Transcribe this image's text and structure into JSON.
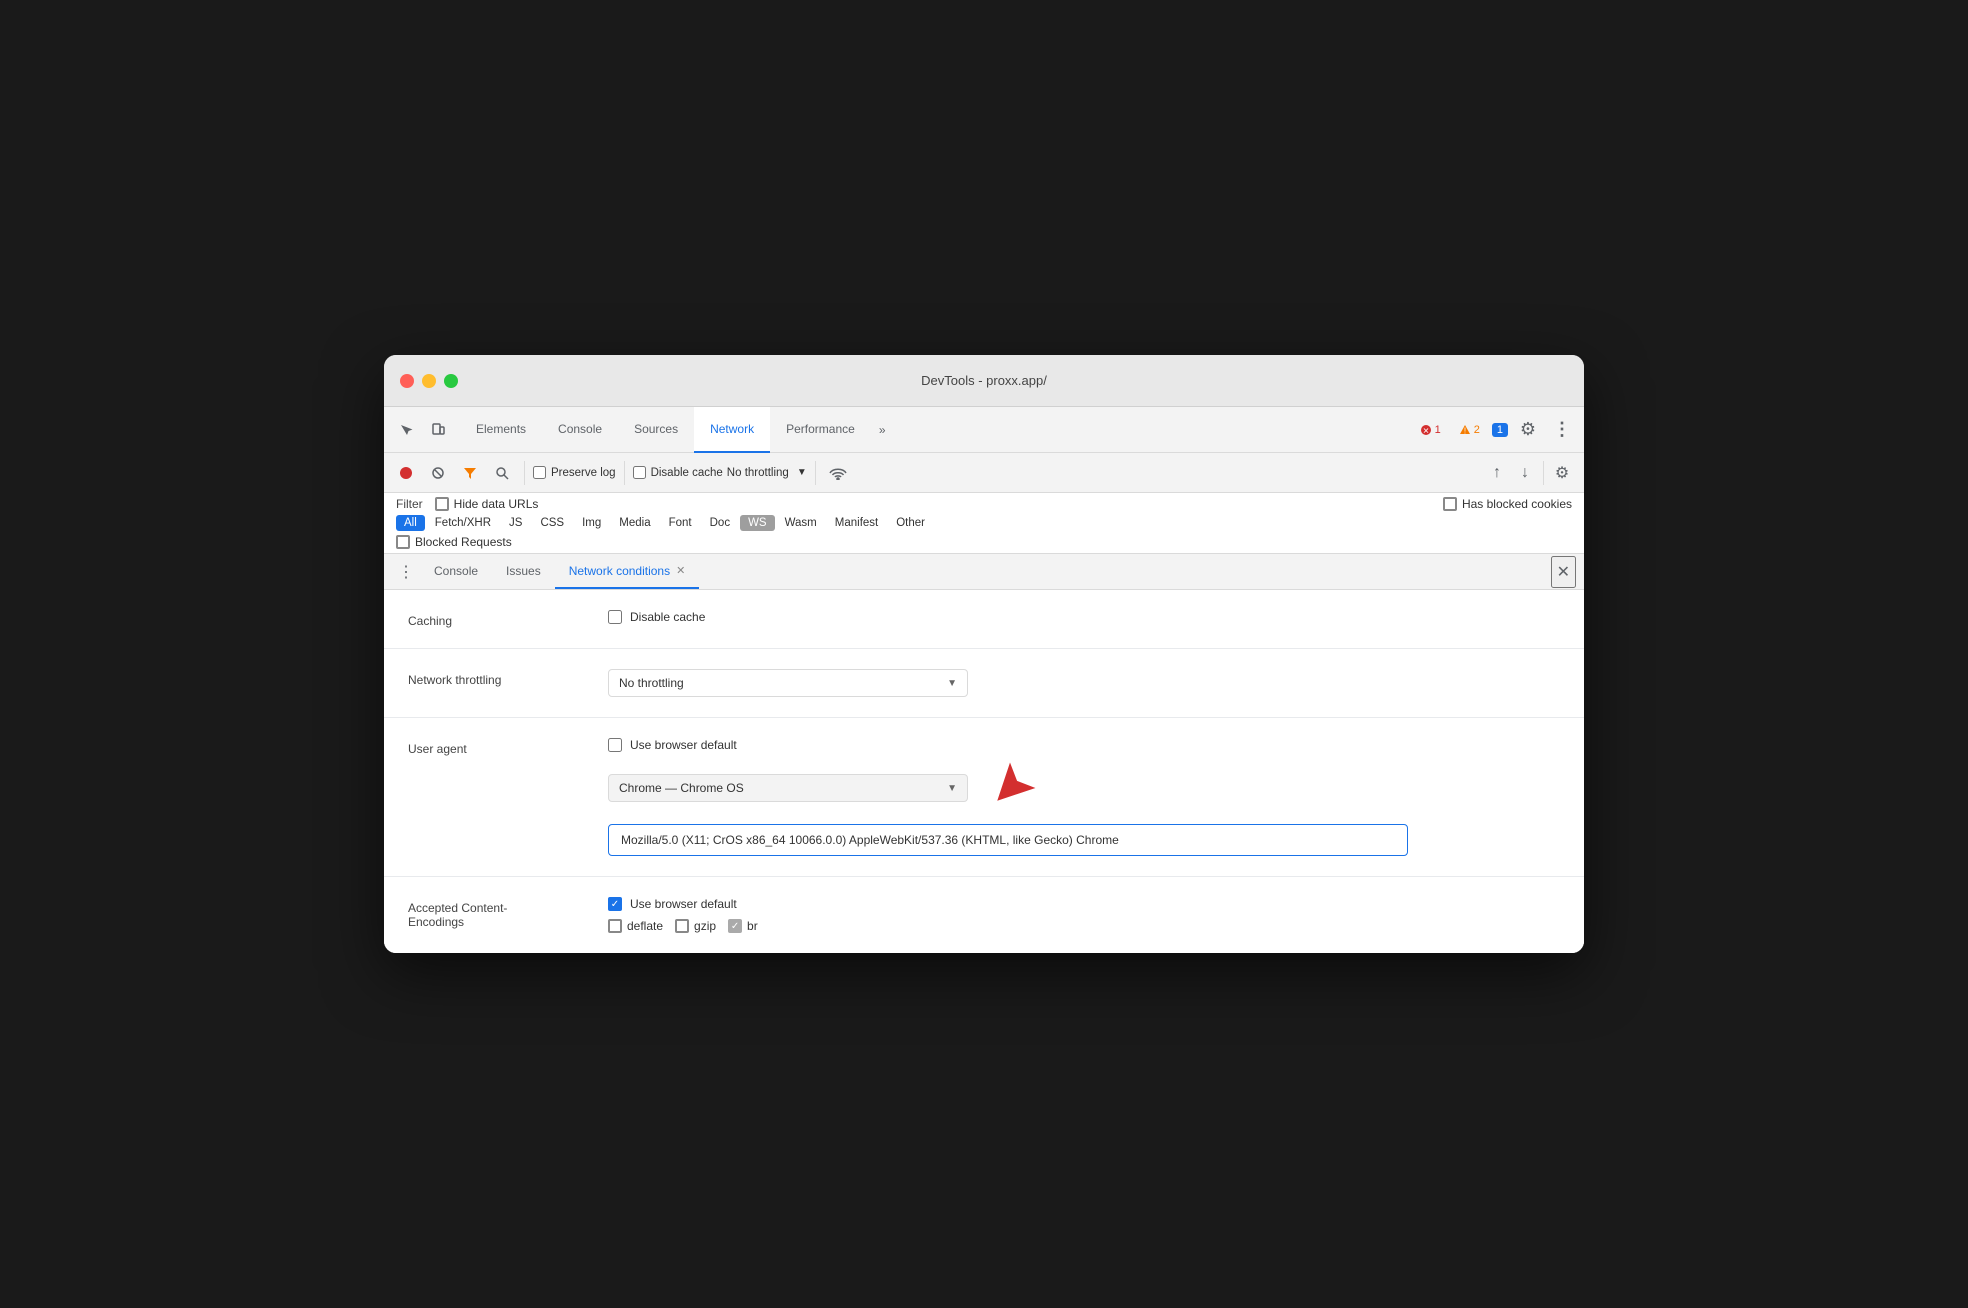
{
  "window": {
    "title": "DevTools - proxx.app/",
    "controls": {
      "close_label": "",
      "minimize_label": "",
      "maximize_label": ""
    }
  },
  "top_tabs": {
    "items": [
      {
        "id": "elements",
        "label": "Elements",
        "active": false
      },
      {
        "id": "console",
        "label": "Console",
        "active": false
      },
      {
        "id": "sources",
        "label": "Sources",
        "active": false
      },
      {
        "id": "network",
        "label": "Network",
        "active": true
      },
      {
        "id": "performance",
        "label": "Performance",
        "active": false
      }
    ],
    "more_label": "»",
    "badges": {
      "error": "1",
      "warning": "2",
      "info": "1"
    },
    "settings_label": "⚙",
    "more_options_label": "⋮"
  },
  "toolbar": {
    "record_tooltip": "Record network log",
    "clear_tooltip": "Clear",
    "filter_tooltip": "Filter",
    "search_tooltip": "Search",
    "preserve_log_label": "Preserve log",
    "disable_cache_label": "Disable cache",
    "throttling_label": "No throttling",
    "throttle_arrow": "▼",
    "online_icon": "wifi",
    "upload_icon": "↑",
    "download_icon": "↓",
    "settings_icon": "⚙"
  },
  "filter_bar": {
    "label": "Filter",
    "hide_data_urls_label": "Hide data URLs",
    "types": [
      {
        "id": "all",
        "label": "All",
        "active": true
      },
      {
        "id": "fetch-xhr",
        "label": "Fetch/XHR",
        "active": false
      },
      {
        "id": "js",
        "label": "JS",
        "active": false
      },
      {
        "id": "css",
        "label": "CSS",
        "active": false
      },
      {
        "id": "img",
        "label": "Img",
        "active": false
      },
      {
        "id": "media",
        "label": "Media",
        "active": false
      },
      {
        "id": "font",
        "label": "Font",
        "active": false
      },
      {
        "id": "doc",
        "label": "Doc",
        "active": false
      },
      {
        "id": "ws",
        "label": "WS",
        "active": false,
        "special": true
      },
      {
        "id": "wasm",
        "label": "Wasm",
        "active": false
      },
      {
        "id": "manifest",
        "label": "Manifest",
        "active": false
      },
      {
        "id": "other",
        "label": "Other",
        "active": false
      }
    ],
    "has_blocked_cookies_label": "Has blocked cookies",
    "blocked_requests_label": "Blocked Requests"
  },
  "drawer_tabs": {
    "items": [
      {
        "id": "console",
        "label": "Console",
        "active": false
      },
      {
        "id": "issues",
        "label": "Issues",
        "active": false
      },
      {
        "id": "network-conditions",
        "label": "Network conditions",
        "active": true
      }
    ],
    "menu_icon": "⋮",
    "close_icon": "✕"
  },
  "network_conditions": {
    "sections": {
      "caching": {
        "label": "Caching",
        "disable_cache_label": "Disable cache",
        "disable_cache_checked": false
      },
      "network_throttling": {
        "label": "Network throttling",
        "selected_option": "No throttling",
        "dropdown_arrow": "▼"
      },
      "user_agent": {
        "label": "User agent",
        "use_browser_default_label": "Use browser default",
        "use_browser_default_checked": false,
        "selected_ua": "Chrome — Chrome OS",
        "dropdown_arrow": "▼",
        "ua_string": "Mozilla/5.0 (X11; CrOS x86_64 10066.0.0) AppleWebKit/537.36 (KHTML, like Gecko) Chrome"
      },
      "accepted_content_encodings": {
        "label": "Accepted Content-\nEncodings",
        "use_browser_default_label": "Use browser default",
        "use_browser_default_checked": true,
        "encodings": [
          {
            "id": "deflate",
            "label": "deflate",
            "checked": false
          },
          {
            "id": "gzip",
            "label": "gzip",
            "checked": false
          },
          {
            "id": "br",
            "label": "br",
            "checked": true,
            "partial": true
          }
        ]
      }
    }
  }
}
